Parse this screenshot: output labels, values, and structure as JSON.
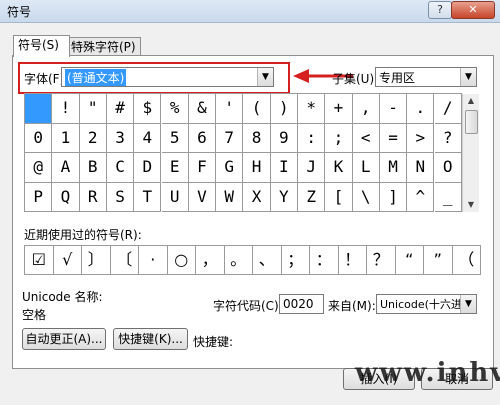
{
  "window": {
    "title": "符号",
    "help": "?",
    "close": "✕"
  },
  "tabs": [
    "符号(S)",
    "特殊字符(P)"
  ],
  "font": {
    "label": "字体(F):",
    "value": "(普通文本)"
  },
  "subset": {
    "label": "子集(U):",
    "value": "专用区"
  },
  "symbols": [
    [
      "",
      "!",
      "\"",
      "#",
      "$",
      "%",
      "&",
      "'",
      "(",
      ")",
      "*",
      "+",
      ",",
      "-",
      ".",
      "/"
    ],
    [
      "0",
      "1",
      "2",
      "3",
      "4",
      "5",
      "6",
      "7",
      "8",
      "9",
      ":",
      ";",
      "<",
      "=",
      ">",
      "?"
    ],
    [
      "@",
      "A",
      "B",
      "C",
      "D",
      "E",
      "F",
      "G",
      "H",
      "I",
      "J",
      "K",
      "L",
      "M",
      "N",
      "O"
    ],
    [
      "P",
      "Q",
      "R",
      "S",
      "T",
      "U",
      "V",
      "W",
      "X",
      "Y",
      "Z",
      "[",
      "\\",
      "]",
      "^",
      "_"
    ]
  ],
  "recent": {
    "label": "近期使用过的符号(R):",
    "symbols": [
      "☑",
      "√",
      "〕",
      "〔",
      "·",
      "○",
      "，",
      "。",
      "、",
      "；",
      "：",
      "！",
      "？",
      "“",
      "”",
      "（"
    ]
  },
  "unicode": {
    "name_label": "Unicode 名称:",
    "name_value": "空格",
    "code_label": "字符代码(C):",
    "code_value": "0020",
    "from_label": "来自(M):",
    "from_value": "Unicode(十六进"
  },
  "buttons": {
    "autocorrect": "自动更正(A)...",
    "shortcut": "快捷键(K)...",
    "shortcut_label": "快捷键:",
    "insert": "插入(I)",
    "cancel": "取消"
  },
  "watermark": "www.inhv.cn",
  "colors": {
    "highlight": "#d62020",
    "selection": "#3399ff"
  }
}
